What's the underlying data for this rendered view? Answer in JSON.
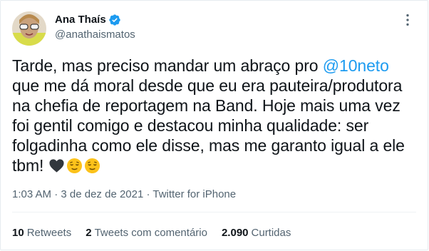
{
  "author": {
    "name": "Ana Thaís",
    "handle": "@anathaismatos"
  },
  "tweet": {
    "text_before": "Tarde, mas preciso mandar um abraço pro ",
    "mention": "@10neto",
    "text_after": " que me dá moral desde que eu era pauteira/produtora na chefia de reportagem na Band. Hoje mais uma vez foi gentil comigo e destacou minha qualidade: ser folgadinha como ele disse, mas me garanto igual a ele tbm! ",
    "emojis": [
      "black-heart",
      "relieved-face",
      "relieved-face"
    ]
  },
  "meta": {
    "time": "1:03 AM",
    "separator1": " · ",
    "date": "3 de dez de 2021",
    "separator2": " · ",
    "source": "Twitter for iPhone"
  },
  "stats": {
    "retweets_count": "10",
    "retweets_label": "Retweets",
    "quotes_count": "2",
    "quotes_label": "Tweets com comentário",
    "likes_count": "2.090",
    "likes_label": "Curtidas"
  },
  "colors": {
    "accent": "#1d9bf0",
    "secondary_text": "#536471"
  }
}
